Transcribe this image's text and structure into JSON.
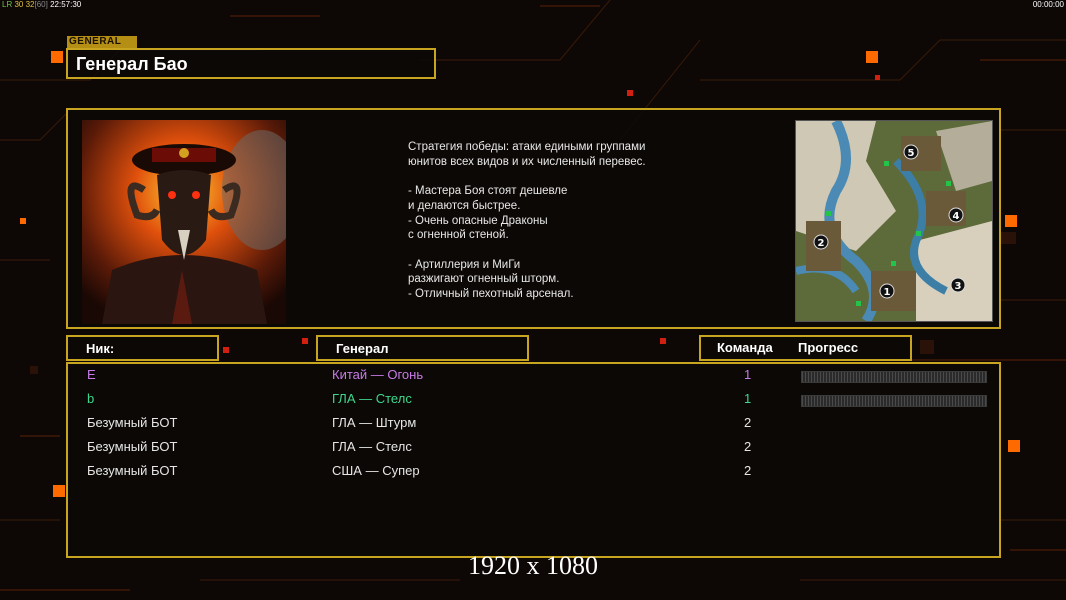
{
  "topbar": {
    "left_prefix": "LR",
    "left_fps": "30 32",
    "left_fps_limit": "[60]",
    "left_clock": "22:57:30",
    "right_clock": "00:00:00"
  },
  "header": {
    "category_label": "GENERAL",
    "general_name": "Генерал Бао"
  },
  "general_info": {
    "description": "Стратегия победы: атаки едиными группами\nюнитов всех видов и их численный перевес.\n\n- Мастера Боя стоят дешевле\nи делаются быстрее.\n- Очень опасные Драконы\nс огненной стеной.\n\n- Артиллерия и МиГи\nразжигают огненный шторм.\n- Отличный пехотный арсенал.",
    "portrait_icon": "general-portrait",
    "map_icon": "minimap",
    "map_spawns": [
      "1",
      "2",
      "3",
      "4",
      "5"
    ]
  },
  "table": {
    "headers": {
      "nick": "Ник:",
      "general": "Генерал",
      "team": "Команда",
      "progress": "Прогресс"
    },
    "players": [
      {
        "nick": "E",
        "general": "Китай — Огонь",
        "team": "1",
        "color": "#c77be6",
        "progress": 0
      },
      {
        "nick": "b",
        "general": "ГЛА — Стелс",
        "team": "1",
        "color": "#3fd78c",
        "progress": 0
      },
      {
        "nick": "Безумный БОТ",
        "general": "ГЛА — Штурм",
        "team": "2",
        "color": "#e6e6e6"
      },
      {
        "nick": "Безумный БОТ",
        "general": "ГЛА — Стелс",
        "team": "2",
        "color": "#e6e6e6"
      },
      {
        "nick": "Безумный БОТ",
        "general": "США — Супер",
        "team": "2",
        "color": "#e6e6e6"
      }
    ]
  },
  "resolution_overlay": "1920 x 1080",
  "colors": {
    "accent_yellow": "#c8a520",
    "accent_orange": "#ff6a00",
    "player_china": "#c77be6",
    "player_gla": "#3fd78c"
  }
}
